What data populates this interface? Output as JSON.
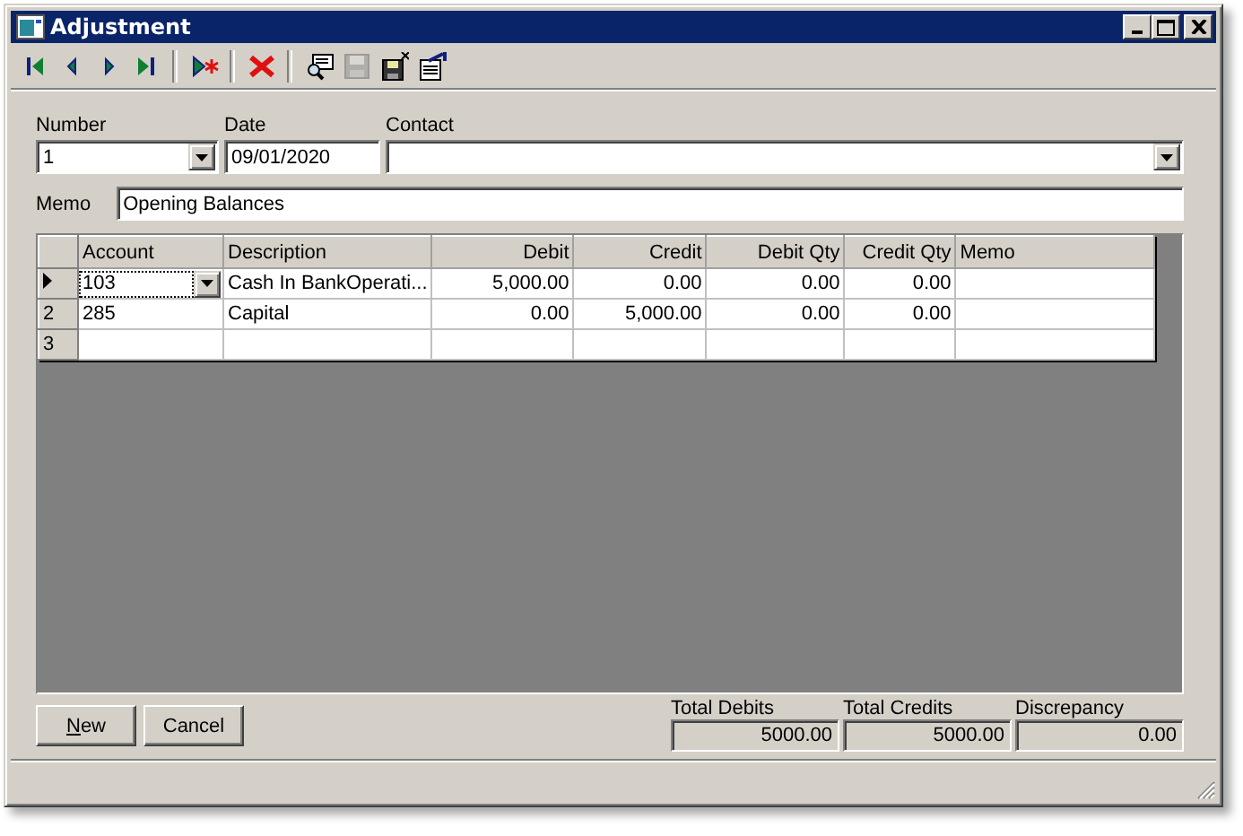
{
  "window": {
    "title": "Adjustment"
  },
  "toolbar": [
    {
      "kind": "first",
      "disabled": false
    },
    {
      "kind": "prev",
      "disabled": false
    },
    {
      "kind": "next",
      "disabled": false
    },
    {
      "kind": "last",
      "disabled": false
    },
    {
      "kind": "sep"
    },
    {
      "kind": "new",
      "disabled": false
    },
    {
      "kind": "sep"
    },
    {
      "kind": "delete",
      "disabled": false
    },
    {
      "kind": "sep"
    },
    {
      "kind": "find",
      "disabled": false
    },
    {
      "kind": "save",
      "disabled": true
    },
    {
      "kind": "saveclose",
      "disabled": false
    },
    {
      "kind": "properties",
      "disabled": false
    }
  ],
  "form": {
    "number": {
      "label": "Number",
      "value": "1"
    },
    "date": {
      "label": "Date",
      "value": "09/01/2020"
    },
    "contact": {
      "label": "Contact"
    },
    "memo": {
      "label": "Memo",
      "value": "Opening Balances"
    }
  },
  "grid": {
    "columns": [
      {
        "label": "Account",
        "kind": "text"
      },
      {
        "label": "Description",
        "kind": "text"
      },
      {
        "label": "Debit",
        "kind": "number"
      },
      {
        "label": "Credit",
        "kind": "number"
      },
      {
        "label": "Debit Qty",
        "kind": "number"
      },
      {
        "label": "Credit Qty",
        "kind": "number"
      },
      {
        "label": "Memo",
        "kind": "text"
      }
    ],
    "rows": [
      {
        "selected": true,
        "cells": [
          "103",
          "Cash In BankOperati...",
          "5,000.00",
          "0.00",
          "0.00",
          "0.00",
          ""
        ]
      },
      {
        "selected": false,
        "header": "2",
        "cells": [
          "285",
          "Capital",
          "0.00",
          "5,000.00",
          "0.00",
          "0.00",
          ""
        ]
      },
      {
        "selected": false,
        "header": "3",
        "cells": [
          "",
          "",
          "",
          "",
          "",
          "",
          ""
        ]
      }
    ]
  },
  "buttons": [
    {
      "label": "New"
    },
    {
      "label": "Cancel"
    }
  ],
  "totals": [
    {
      "label": "Total Debits",
      "value": "5000.00"
    },
    {
      "label": "Total Credits",
      "value": "5000.00"
    },
    {
      "label": "Discrepancy",
      "value": "0.00"
    }
  ]
}
